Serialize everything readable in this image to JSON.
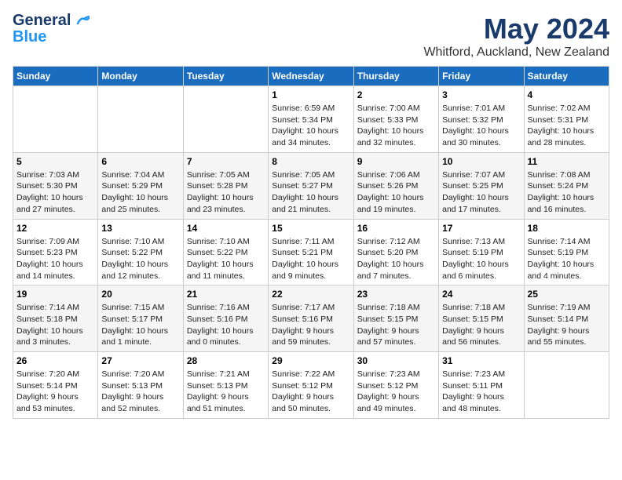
{
  "header": {
    "logo_general": "General",
    "logo_blue": "Blue",
    "month_year": "May 2024",
    "location": "Whitford, Auckland, New Zealand"
  },
  "days_of_week": [
    "Sunday",
    "Monday",
    "Tuesday",
    "Wednesday",
    "Thursday",
    "Friday",
    "Saturday"
  ],
  "weeks": [
    [
      {
        "day": "",
        "detail": ""
      },
      {
        "day": "",
        "detail": ""
      },
      {
        "day": "",
        "detail": ""
      },
      {
        "day": "1",
        "detail": "Sunrise: 6:59 AM\nSunset: 5:34 PM\nDaylight: 10 hours\nand 34 minutes."
      },
      {
        "day": "2",
        "detail": "Sunrise: 7:00 AM\nSunset: 5:33 PM\nDaylight: 10 hours\nand 32 minutes."
      },
      {
        "day": "3",
        "detail": "Sunrise: 7:01 AM\nSunset: 5:32 PM\nDaylight: 10 hours\nand 30 minutes."
      },
      {
        "day": "4",
        "detail": "Sunrise: 7:02 AM\nSunset: 5:31 PM\nDaylight: 10 hours\nand 28 minutes."
      }
    ],
    [
      {
        "day": "5",
        "detail": "Sunrise: 7:03 AM\nSunset: 5:30 PM\nDaylight: 10 hours\nand 27 minutes."
      },
      {
        "day": "6",
        "detail": "Sunrise: 7:04 AM\nSunset: 5:29 PM\nDaylight: 10 hours\nand 25 minutes."
      },
      {
        "day": "7",
        "detail": "Sunrise: 7:05 AM\nSunset: 5:28 PM\nDaylight: 10 hours\nand 23 minutes."
      },
      {
        "day": "8",
        "detail": "Sunrise: 7:05 AM\nSunset: 5:27 PM\nDaylight: 10 hours\nand 21 minutes."
      },
      {
        "day": "9",
        "detail": "Sunrise: 7:06 AM\nSunset: 5:26 PM\nDaylight: 10 hours\nand 19 minutes."
      },
      {
        "day": "10",
        "detail": "Sunrise: 7:07 AM\nSunset: 5:25 PM\nDaylight: 10 hours\nand 17 minutes."
      },
      {
        "day": "11",
        "detail": "Sunrise: 7:08 AM\nSunset: 5:24 PM\nDaylight: 10 hours\nand 16 minutes."
      }
    ],
    [
      {
        "day": "12",
        "detail": "Sunrise: 7:09 AM\nSunset: 5:23 PM\nDaylight: 10 hours\nand 14 minutes."
      },
      {
        "day": "13",
        "detail": "Sunrise: 7:10 AM\nSunset: 5:22 PM\nDaylight: 10 hours\nand 12 minutes."
      },
      {
        "day": "14",
        "detail": "Sunrise: 7:10 AM\nSunset: 5:22 PM\nDaylight: 10 hours\nand 11 minutes."
      },
      {
        "day": "15",
        "detail": "Sunrise: 7:11 AM\nSunset: 5:21 PM\nDaylight: 10 hours\nand 9 minutes."
      },
      {
        "day": "16",
        "detail": "Sunrise: 7:12 AM\nSunset: 5:20 PM\nDaylight: 10 hours\nand 7 minutes."
      },
      {
        "day": "17",
        "detail": "Sunrise: 7:13 AM\nSunset: 5:19 PM\nDaylight: 10 hours\nand 6 minutes."
      },
      {
        "day": "18",
        "detail": "Sunrise: 7:14 AM\nSunset: 5:19 PM\nDaylight: 10 hours\nand 4 minutes."
      }
    ],
    [
      {
        "day": "19",
        "detail": "Sunrise: 7:14 AM\nSunset: 5:18 PM\nDaylight: 10 hours\nand 3 minutes."
      },
      {
        "day": "20",
        "detail": "Sunrise: 7:15 AM\nSunset: 5:17 PM\nDaylight: 10 hours\nand 1 minute."
      },
      {
        "day": "21",
        "detail": "Sunrise: 7:16 AM\nSunset: 5:16 PM\nDaylight: 10 hours\nand 0 minutes."
      },
      {
        "day": "22",
        "detail": "Sunrise: 7:17 AM\nSunset: 5:16 PM\nDaylight: 9 hours\nand 59 minutes."
      },
      {
        "day": "23",
        "detail": "Sunrise: 7:18 AM\nSunset: 5:15 PM\nDaylight: 9 hours\nand 57 minutes."
      },
      {
        "day": "24",
        "detail": "Sunrise: 7:18 AM\nSunset: 5:15 PM\nDaylight: 9 hours\nand 56 minutes."
      },
      {
        "day": "25",
        "detail": "Sunrise: 7:19 AM\nSunset: 5:14 PM\nDaylight: 9 hours\nand 55 minutes."
      }
    ],
    [
      {
        "day": "26",
        "detail": "Sunrise: 7:20 AM\nSunset: 5:14 PM\nDaylight: 9 hours\nand 53 minutes."
      },
      {
        "day": "27",
        "detail": "Sunrise: 7:20 AM\nSunset: 5:13 PM\nDaylight: 9 hours\nand 52 minutes."
      },
      {
        "day": "28",
        "detail": "Sunrise: 7:21 AM\nSunset: 5:13 PM\nDaylight: 9 hours\nand 51 minutes."
      },
      {
        "day": "29",
        "detail": "Sunrise: 7:22 AM\nSunset: 5:12 PM\nDaylight: 9 hours\nand 50 minutes."
      },
      {
        "day": "30",
        "detail": "Sunrise: 7:23 AM\nSunset: 5:12 PM\nDaylight: 9 hours\nand 49 minutes."
      },
      {
        "day": "31",
        "detail": "Sunrise: 7:23 AM\nSunset: 5:11 PM\nDaylight: 9 hours\nand 48 minutes."
      },
      {
        "day": "",
        "detail": ""
      }
    ]
  ]
}
